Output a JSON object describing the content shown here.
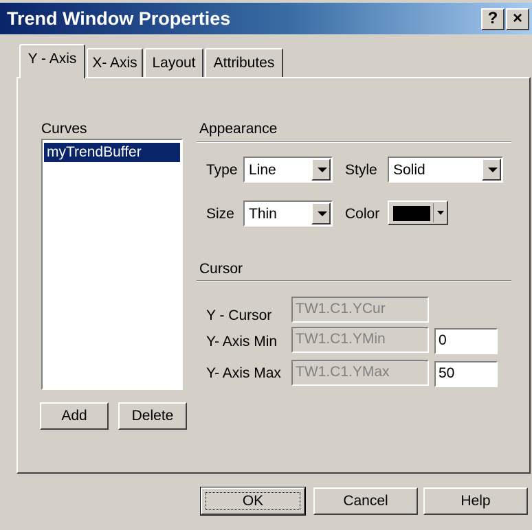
{
  "window": {
    "title": "Trend Window Properties",
    "help_glyph": "?",
    "close_glyph": "×"
  },
  "tabs": [
    {
      "label": "Y - Axis",
      "active": true
    },
    {
      "label": "X- Axis",
      "active": false
    },
    {
      "label": "Layout",
      "active": false
    },
    {
      "label": "Attributes",
      "active": false
    }
  ],
  "curves": {
    "label": "Curves",
    "items": [
      "myTrendBuffer"
    ],
    "selected": "myTrendBuffer",
    "add_label": "Add",
    "delete_label": "Delete"
  },
  "appearance": {
    "label": "Appearance",
    "type_label": "Type",
    "type_value": "Line",
    "style_label": "Style",
    "style_value": "Solid",
    "size_label": "Size",
    "size_value": "Thin",
    "color_label": "Color",
    "color_value": "#000000"
  },
  "cursor": {
    "label": "Cursor",
    "y_cursor_label": "Y - Cursor",
    "y_cursor_value": "TW1.C1.YCur",
    "y_min_label": "Y- Axis Min",
    "y_min_var": "TW1.C1.YMin",
    "y_min_value": "0",
    "y_max_label": "Y- Axis Max",
    "y_max_var": "TW1.C1.YMax",
    "y_max_value": "50"
  },
  "footer": {
    "ok_label": "OK",
    "cancel_label": "Cancel",
    "help_label": "Help"
  },
  "colors": {
    "title_gradient_start": "#0a246a",
    "title_gradient_end": "#a6caf0",
    "selection": "#0a246a",
    "face": "#d4d0c8"
  }
}
